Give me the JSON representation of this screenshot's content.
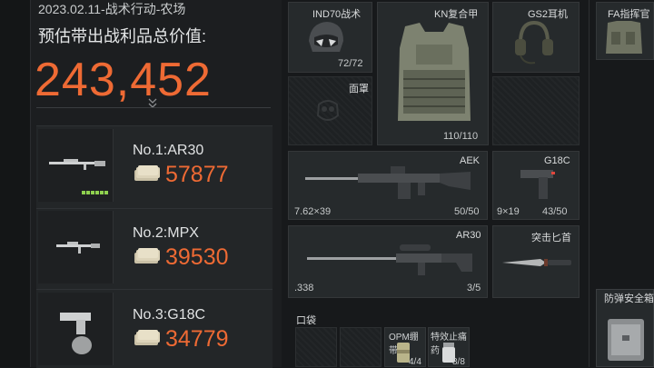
{
  "header": {
    "date_mode_map": "2023.02.11-战术行动-农场",
    "value_label": "预估带出战利品总价值:",
    "total_value": "243,452"
  },
  "top_items": [
    {
      "rank": "No.1:AR30",
      "price": "57877"
    },
    {
      "rank": "No.2:MPX",
      "price": "39530"
    },
    {
      "rank": "No.3:G18C",
      "price": "34779"
    }
  ],
  "equipment": {
    "helmet": {
      "name": "IND70战术",
      "durability": "72/72"
    },
    "armor": {
      "name": "KN复合甲",
      "durability": "110/110"
    },
    "headset": {
      "name": "GS2耳机"
    },
    "rig": {
      "name": "FA指挥官"
    },
    "mask": {
      "name": "面罩"
    },
    "primary": {
      "name": "AEK",
      "caliber": "7.62×39",
      "ammo": "50/50"
    },
    "sidearm": {
      "name": "G18C",
      "caliber": "9×19",
      "ammo": "43/50"
    },
    "secondary": {
      "name": "AR30",
      "caliber": ".338",
      "ammo": "3/5"
    },
    "melee": {
      "name": "突击匕首"
    },
    "safe_box": {
      "name": "防弹安全箱"
    }
  },
  "pockets": {
    "label": "口袋",
    "items": [
      {
        "name": "OPM绷带",
        "count": "4/4"
      },
      {
        "name": "特效止痛药",
        "count": "8/8"
      }
    ]
  },
  "colors": {
    "accent": "#ee6a34",
    "durability_green": "#8fd14f",
    "background": "#17191b"
  }
}
